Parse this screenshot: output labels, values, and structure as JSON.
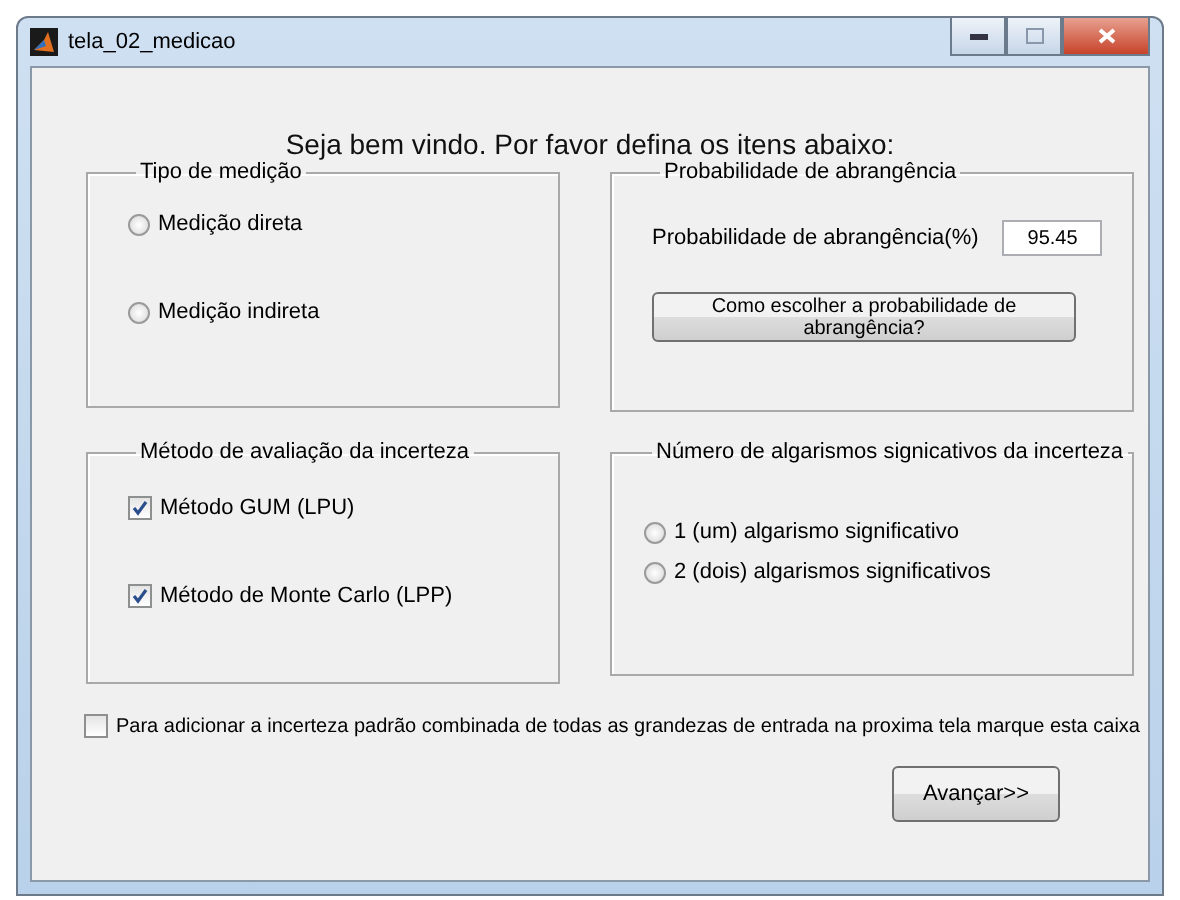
{
  "window": {
    "title": "tela_02_medicao"
  },
  "welcome": "Seja bem vindo. Por favor defina os itens abaixo:",
  "measurement_type": {
    "title": "Tipo de medição",
    "options": [
      {
        "label": "Medição direta",
        "selected": false
      },
      {
        "label": "Medição indireta",
        "selected": false
      }
    ]
  },
  "coverage": {
    "title": "Probabilidade de abrangência",
    "field_label": "Probabilidade de abrangência(%)",
    "value": "95.45",
    "help_button": "Como escolher a probabilidade de abrangência?"
  },
  "evaluation_method": {
    "title": "Método de avaliação da incerteza",
    "options": [
      {
        "label": "Método GUM (LPU)",
        "checked": true
      },
      {
        "label": "Método de Monte Carlo (LPP)",
        "checked": true
      }
    ]
  },
  "significant_digits": {
    "title": "Número de algarismos signicativos da incerteza",
    "options": [
      {
        "label": "1 (um) algarismo significativo",
        "selected": false
      },
      {
        "label": "2 (dois) algarismos significativos",
        "selected": false
      }
    ]
  },
  "combined_uncertainty": {
    "label": "Para adicionar a incerteza padrão combinada de todas as grandezas de entrada na proxima tela marque esta caixa",
    "checked": false
  },
  "next_button": "Avançar>>"
}
